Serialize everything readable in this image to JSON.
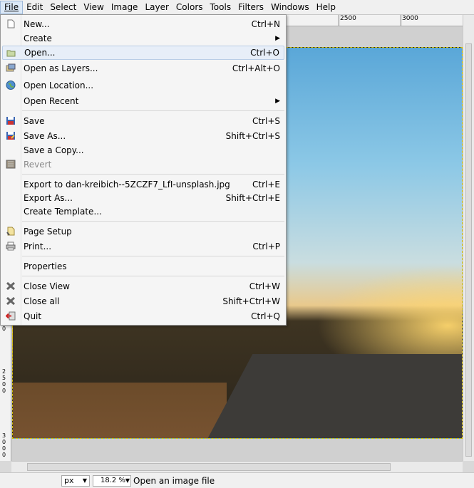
{
  "menubar": [
    "File",
    "Edit",
    "Select",
    "View",
    "Image",
    "Layer",
    "Colors",
    "Tools",
    "Filters",
    "Windows",
    "Help"
  ],
  "ruler_top": {
    "labels": [
      "2500",
      "3000"
    ]
  },
  "ruler_left": {
    "labels": [
      "0",
      "2500",
      "3000"
    ]
  },
  "file_menu": {
    "items": [
      {
        "label": "New...",
        "accel": "Ctrl+N",
        "icon": "new-document-icon"
      },
      {
        "label": "Create",
        "accel": "",
        "icon": "",
        "submenu": true
      },
      {
        "label": "Open...",
        "accel": "Ctrl+O",
        "icon": "folder-open-icon",
        "highlighted": true
      },
      {
        "label": "Open as Layers...",
        "accel": "Ctrl+Alt+O",
        "icon": "open-layers-icon"
      },
      {
        "label": "Open Location...",
        "accel": "",
        "icon": "globe-icon"
      },
      {
        "label": "Open Recent",
        "accel": "",
        "icon": "",
        "submenu": true
      },
      {
        "label": "Save",
        "accel": "Ctrl+S",
        "icon": "save-icon"
      },
      {
        "label": "Save As...",
        "accel": "Shift+Ctrl+S",
        "icon": "save-as-icon"
      },
      {
        "label": "Save a Copy...",
        "accel": "",
        "icon": ""
      },
      {
        "label": "Revert",
        "accel": "",
        "icon": "revert-icon",
        "disabled": true
      },
      {
        "label": "Export to dan-kreibich--5ZCZF7_LfI-unsplash.jpg",
        "accel": "Ctrl+E",
        "icon": ""
      },
      {
        "label": "Export As...",
        "accel": "Shift+Ctrl+E",
        "icon": ""
      },
      {
        "label": "Create Template...",
        "accel": "",
        "icon": ""
      },
      {
        "label": "Page Setup",
        "accel": "",
        "icon": "page-setup-icon"
      },
      {
        "label": "Print...",
        "accel": "Ctrl+P",
        "icon": "printer-icon"
      },
      {
        "label": "Properties",
        "accel": "",
        "icon": ""
      },
      {
        "label": "Close View",
        "accel": "Ctrl+W",
        "icon": "close-icon"
      },
      {
        "label": "Close all",
        "accel": "Shift+Ctrl+W",
        "icon": "close-all-icon"
      },
      {
        "label": "Quit",
        "accel": "Ctrl+Q",
        "icon": "quit-icon"
      }
    ],
    "submenu_arrow": "▶"
  },
  "statusbar": {
    "unit": "px",
    "zoom": "18.2 %",
    "message": "Open an image file"
  },
  "colors": {
    "accent": "#e7eef8",
    "selection_border": "#d8c200"
  }
}
